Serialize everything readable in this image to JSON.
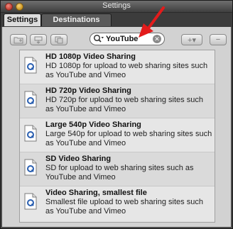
{
  "window": {
    "title": "Settings"
  },
  "tabs": [
    {
      "label": "Settings"
    },
    {
      "label": "Destinations"
    }
  ],
  "search": {
    "value": "YouTube"
  },
  "toolbar": {
    "add_label": "+▾",
    "remove_label": "−"
  },
  "presets": [
    {
      "title": "HD 1080p Video Sharing",
      "description": "HD 1080p for upload to web sharing sites such as YouTube and Vimeo"
    },
    {
      "title": "HD 720p Video Sharing",
      "description": "HD 720p for upload to web sharing sites such as YouTube and Vimeo"
    },
    {
      "title": "Large 540p Video Sharing",
      "description": "Large 540p for upload to web sharing sites such as YouTube and Vimeo"
    },
    {
      "title": "SD Video Sharing",
      "description": "SD for upload to web sharing sites such as YouTube and Vimeo"
    },
    {
      "title": "Video Sharing, smallest file",
      "description": "Smallest file upload to web sharing sites such as YouTube and Vimeo"
    }
  ],
  "icons": {
    "preset": "document-q-icon",
    "folder": "folder-add-icon",
    "share": "share-icon",
    "copy": "duplicate-icon",
    "search": "search-icon",
    "clear": "clear-search-icon",
    "annotation": "red-arrow-icon"
  },
  "colors": {
    "annotation_arrow": "#e31b1b",
    "icon_q": "#2a5fb0"
  }
}
